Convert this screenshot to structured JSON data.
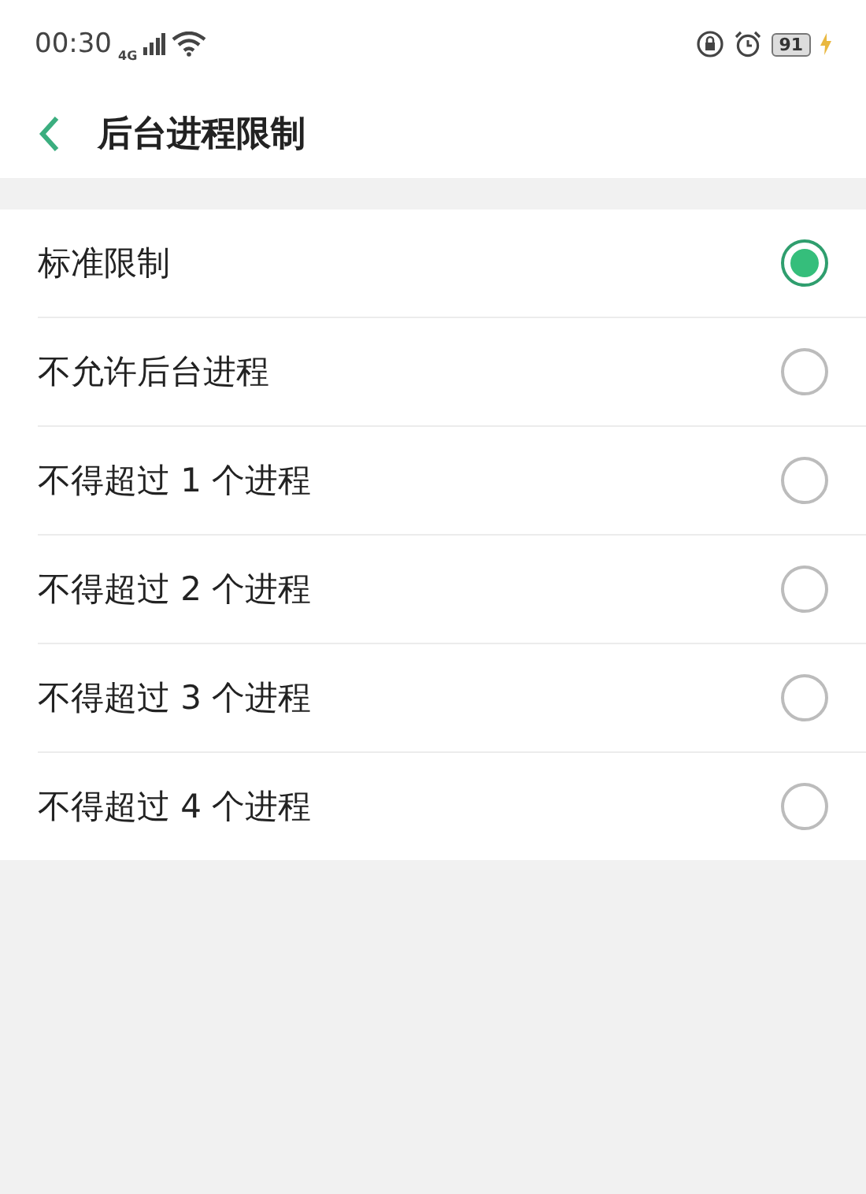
{
  "status_bar": {
    "time": "00:30",
    "network": "4G",
    "battery": "91"
  },
  "header": {
    "title": "后台进程限制"
  },
  "options": [
    {
      "label": "标准限制",
      "selected": true
    },
    {
      "label": "不允许后台进程",
      "selected": false
    },
    {
      "label": "不得超过 1 个进程",
      "selected": false
    },
    {
      "label": "不得超过 2 个进程",
      "selected": false
    },
    {
      "label": "不得超过 3 个进程",
      "selected": false
    },
    {
      "label": "不得超过 4 个进程",
      "selected": false
    }
  ]
}
